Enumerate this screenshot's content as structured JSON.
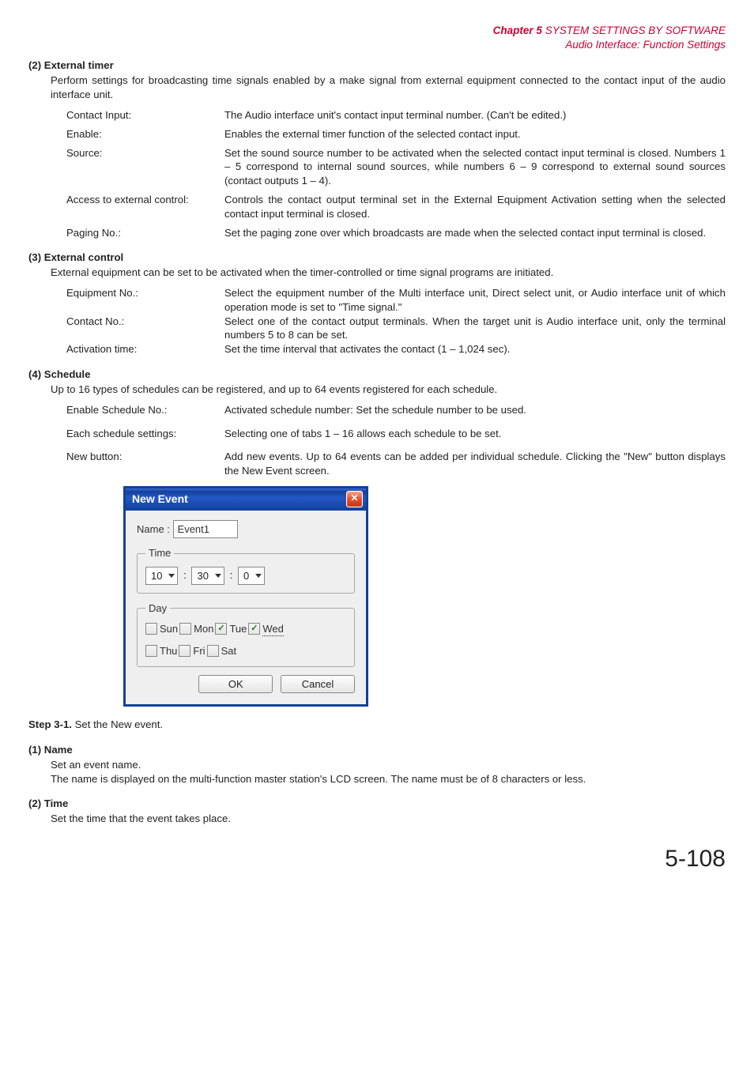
{
  "header": {
    "chapter_prefix": "Chapter 5",
    "chapter_title": "  SYSTEM SETTINGS BY SOFTWARE",
    "subtitle": "Audio Interface: Function Settings"
  },
  "s2": {
    "num": "(2)",
    "title": "External timer",
    "desc": "Perform settings for broadcasting time signals enabled by a make signal from external equipment connected to the contact input of the audio interface unit.",
    "items": [
      {
        "label": "Contact Input:",
        "val": "The Audio interface unit's contact input terminal number. (Can't be edited.)"
      },
      {
        "label": "Enable:",
        "val": "Enables the external timer function of the selected contact input."
      },
      {
        "label": "Source:",
        "val": "Set the sound source number to be activated when the selected contact input terminal is closed. Numbers 1 – 5 correspond to internal sound sources, while numbers 6 – 9 correspond to external sound sources (contact outputs 1 – 4)."
      },
      {
        "label": "Access to external control:",
        "val": "Controls the contact output terminal set in the External Equipment Activation setting when the selected contact input terminal is closed."
      },
      {
        "label": "Paging No.:",
        "val": "Set the paging zone over which broadcasts are made when the selected contact input terminal is closed."
      }
    ]
  },
  "s3": {
    "num": "(3)",
    "title": "External control",
    "desc": "External equipment can be set to be activated when the timer-controlled or time signal programs are initiated.",
    "items": [
      {
        "label": "Equipment No.:",
        "val": "Select the equipment number of the Multi interface unit, Direct select unit, or Audio interface unit of which operation mode is set to \"Time signal.\""
      },
      {
        "label": "Contact No.:",
        "val": "Select one of the contact output terminals. When the target unit is Audio interface unit, only the terminal numbers 5 to 8 can be set."
      },
      {
        "label": "Activation time:",
        "val": "Set the time interval that activates the contact (1 – 1,024 sec)."
      }
    ]
  },
  "s4": {
    "num": "(4)",
    "title": "Schedule",
    "desc": "Up to 16 types of schedules can be registered, and up to 64 events registered for each schedule.",
    "items": [
      {
        "label": "Enable Schedule No.:",
        "val": "Activated schedule number: Set the schedule number to be used."
      },
      {
        "label": "Each schedule settings:",
        "val": "Selecting one of tabs 1 – 16 allows each schedule to be set."
      },
      {
        "label": "New button:",
        "val": "Add new events. Up to 64 events can be added per individual schedule. Clicking the \"New\" button displays the New Event screen."
      }
    ]
  },
  "dialog": {
    "title": "New Event",
    "close_glyph": "✕",
    "name_label": "Name :",
    "name_value": "Event1",
    "time_legend": "Time",
    "time_h": "10",
    "time_m": "30",
    "time_s": "0",
    "sep": ":",
    "day_legend": "Day",
    "days": [
      {
        "label": "Sun",
        "checked": false,
        "focused": false
      },
      {
        "label": "Mon",
        "checked": false,
        "focused": false
      },
      {
        "label": "Tue",
        "checked": true,
        "focused": false
      },
      {
        "label": "Wed",
        "checked": true,
        "focused": true
      },
      {
        "label": "Thu",
        "checked": false,
        "focused": false
      },
      {
        "label": "Fri",
        "checked": false,
        "focused": false
      },
      {
        "label": "Sat",
        "checked": false,
        "focused": false
      }
    ],
    "ok": "OK",
    "cancel": "Cancel"
  },
  "step": {
    "title": "Step 3-1.",
    "text": "Set the New event."
  },
  "sub1": {
    "num": "(1)",
    "title": "Name",
    "desc": "Set an event name.\nThe name is displayed on the multi-function master station's LCD screen. The name must be of 8 characters or less."
  },
  "sub2": {
    "num": "(2)",
    "title": "Time",
    "desc": "Set the time that the event takes place."
  },
  "page_number": "5-108"
}
